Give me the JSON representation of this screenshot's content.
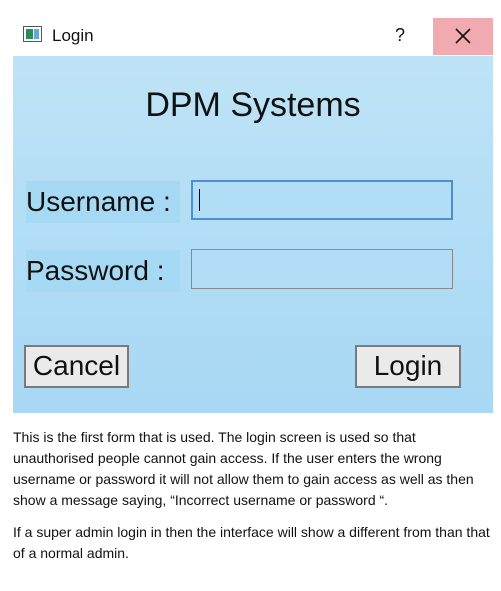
{
  "window": {
    "title": "Login",
    "help_label": "?",
    "close_label": "✕"
  },
  "form": {
    "heading": "DPM Systems",
    "username_label": "Username :",
    "password_label": "Password  :",
    "username_value": "",
    "password_value": "",
    "cancel_label": "Cancel",
    "login_label": "Login"
  },
  "description": {
    "paragraph1": "This is the first form that is used. The login screen is used so that unauthorised people cannot gain access. If the user enters the wrong username or password it will not allow them to gain access as well as then show a message saying, “Incorrect username or password “.",
    "paragraph2": "If a super admin login in then the interface will show a different from than that of a normal admin."
  },
  "colors": {
    "client_background": "#b3def6",
    "close_hover": "#f0aab0",
    "focus_border": "#4d8fd0"
  },
  "icons": {
    "window": "app-window-icon",
    "close": "close-icon"
  }
}
